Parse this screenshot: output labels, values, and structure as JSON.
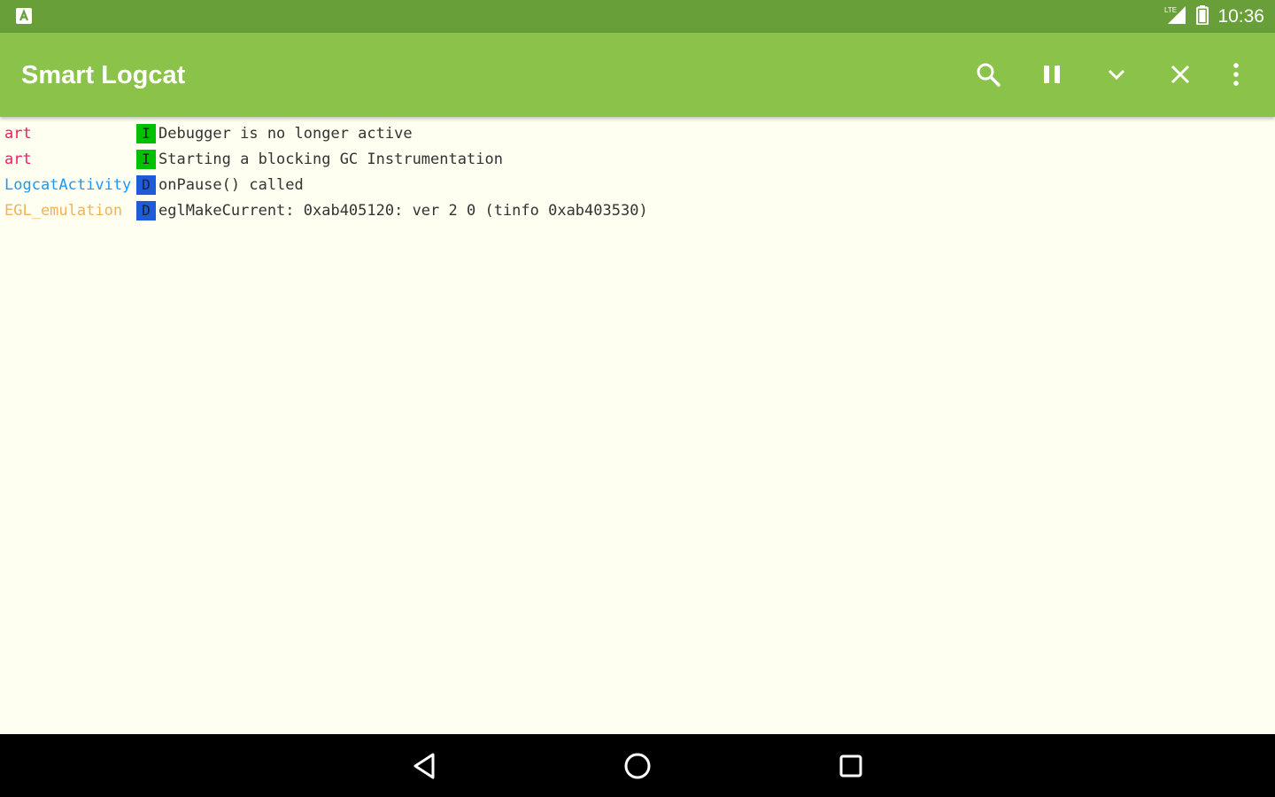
{
  "status_bar": {
    "time": "10:36",
    "app_icon": "a-notification-icon",
    "network_label": "LTE",
    "network_icon": "signal-icon",
    "battery_icon": "battery-icon"
  },
  "toolbar": {
    "title": "Smart Logcat",
    "actions": [
      {
        "name": "search-button",
        "icon": "search-icon"
      },
      {
        "name": "pause-button",
        "icon": "pause-icon"
      },
      {
        "name": "scroll-down-button",
        "icon": "chevron-down-icon"
      },
      {
        "name": "clear-button",
        "icon": "close-icon"
      },
      {
        "name": "overflow-menu-button",
        "icon": "more-vert-icon"
      }
    ],
    "color": "#8bc34a"
  },
  "log_entries": [
    {
      "tag": "art",
      "tag_color": "#e91e63",
      "level": "I",
      "level_color": "#00c000",
      "message": "Debugger is no longer active"
    },
    {
      "tag": "art",
      "tag_color": "#e91e63",
      "level": "I",
      "level_color": "#00c000",
      "message": "Starting a blocking GC Instrumentation"
    },
    {
      "tag": "LogcatActivity",
      "tag_color": "#2196f3",
      "level": "D",
      "level_color": "#1e5bd8",
      "message": "onPause() called"
    },
    {
      "tag": "EGL_emulation",
      "tag_color": "#f0b35a",
      "level": "D",
      "level_color": "#1e5bd8",
      "message": "eglMakeCurrent: 0xab405120: ver 2 0 (tinfo 0xab403530)"
    }
  ],
  "nav_bar": {
    "buttons": [
      {
        "name": "nav-back-button",
        "icon": "back-icon"
      },
      {
        "name": "nav-home-button",
        "icon": "home-icon"
      },
      {
        "name": "nav-recents-button",
        "icon": "recents-icon"
      }
    ]
  },
  "colors": {
    "status_bar": "#689f38",
    "background": "#fefff0"
  }
}
